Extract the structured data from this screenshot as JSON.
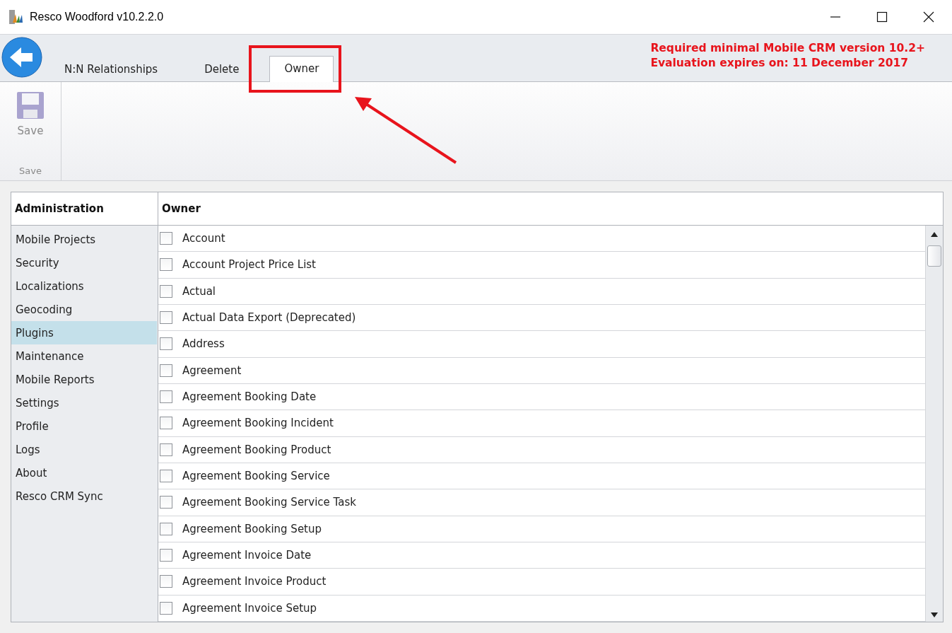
{
  "window": {
    "title": "Resco Woodford v10.2.2.0"
  },
  "tabs": [
    {
      "label": "N:N Relationships",
      "selected": false
    },
    {
      "label": "Delete",
      "selected": false
    },
    {
      "label": "Owner",
      "selected": true
    }
  ],
  "notices": [
    "Required minimal Mobile CRM version 10.2+",
    "Evaluation expires on: 11 December 2017"
  ],
  "toolbar": {
    "buttons": [
      {
        "label": "Save",
        "disabled": true
      }
    ],
    "group_label": "Save"
  },
  "sidebar": {
    "title": "Administration",
    "items": [
      {
        "label": "Mobile Projects",
        "selected": false
      },
      {
        "label": "Security",
        "selected": false
      },
      {
        "label": "Localizations",
        "selected": false
      },
      {
        "label": "Geocoding",
        "selected": false
      },
      {
        "label": "Plugins",
        "selected": true
      },
      {
        "label": "Maintenance",
        "selected": false
      },
      {
        "label": "Mobile Reports",
        "selected": false
      },
      {
        "label": "Settings",
        "selected": false
      },
      {
        "label": "Profile",
        "selected": false
      },
      {
        "label": "Logs",
        "selected": false
      },
      {
        "label": "About",
        "selected": false
      },
      {
        "label": "Resco CRM Sync",
        "selected": false
      }
    ]
  },
  "list": {
    "title": "Owner",
    "rows": [
      {
        "label": "Account",
        "checked": false
      },
      {
        "label": "Account Project Price List",
        "checked": false
      },
      {
        "label": "Actual",
        "checked": false
      },
      {
        "label": "Actual Data Export (Deprecated)",
        "checked": false
      },
      {
        "label": "Address",
        "checked": false
      },
      {
        "label": "Agreement",
        "checked": false
      },
      {
        "label": "Agreement Booking Date",
        "checked": false
      },
      {
        "label": "Agreement Booking Incident",
        "checked": false
      },
      {
        "label": "Agreement Booking Product",
        "checked": false
      },
      {
        "label": "Agreement Booking Service",
        "checked": false
      },
      {
        "label": "Agreement Booking Service Task",
        "checked": false
      },
      {
        "label": "Agreement Booking Setup",
        "checked": false
      },
      {
        "label": "Agreement Invoice Date",
        "checked": false
      },
      {
        "label": "Agreement Invoice Product",
        "checked": false
      },
      {
        "label": "Agreement Invoice Setup",
        "checked": false
      }
    ]
  }
}
